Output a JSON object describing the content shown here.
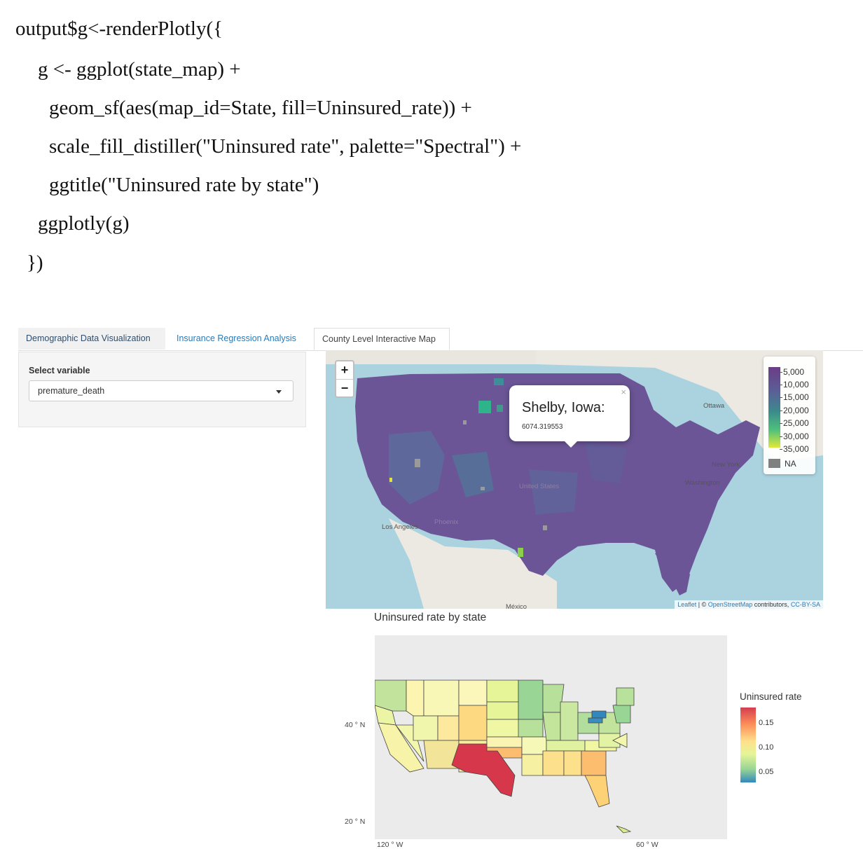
{
  "code": {
    "lines": [
      "output$g<-renderPlotly({",
      "g <- ggplot(state_map) +",
      "geom_sf(aes(map_id=State, fill=Uninsured_rate)) +",
      "scale_fill_distiller(\"Uninsured rate\", palette=\"Spectral\") +",
      "ggtitle(\"Uninsured rate by state\")",
      "ggplotly(g)",
      "})"
    ]
  },
  "tabs": [
    {
      "label": "Demographic Data Visualization"
    },
    {
      "label": "Insurance Regression Analysis"
    },
    {
      "label": "County Level Interactive Map"
    }
  ],
  "sidebar": {
    "select_label": "Select variable",
    "select_value": "premature_death"
  },
  "leaflet": {
    "zoom_in": "+",
    "zoom_out": "−",
    "popup": {
      "title": "Shelby, Iowa:",
      "value": "6074.319553",
      "close": "×"
    },
    "labels": [
      "Ottawa",
      "New York",
      "Washington",
      "United States",
      "Los Angeles",
      "Phoenix",
      "México"
    ],
    "legend": {
      "ticks": [
        "5,000",
        "10,000",
        "15,000",
        "20,000",
        "25,000",
        "30,000",
        "35,000"
      ],
      "na": "NA"
    },
    "attribution": {
      "leaflet": "Leaflet",
      "sep": " | © ",
      "osm": "OpenStreetMap",
      "contrib": " contributors, ",
      "license": "CC-BY-SA"
    }
  },
  "plot": {
    "title": "Uninsured rate by state",
    "y_ticks": [
      "40 ° N",
      "20 ° N"
    ],
    "x_ticks": [
      "120 ° W",
      "60 ° W"
    ],
    "legend_title": "Uninsured rate",
    "legend_ticks": [
      "0.15",
      "0.10",
      "0.05"
    ]
  },
  "colors": {
    "tab_active": "#2a7ab8",
    "map_water": "#aad3df",
    "county_fill": "#6b5596",
    "texas": "#d7374a"
  }
}
